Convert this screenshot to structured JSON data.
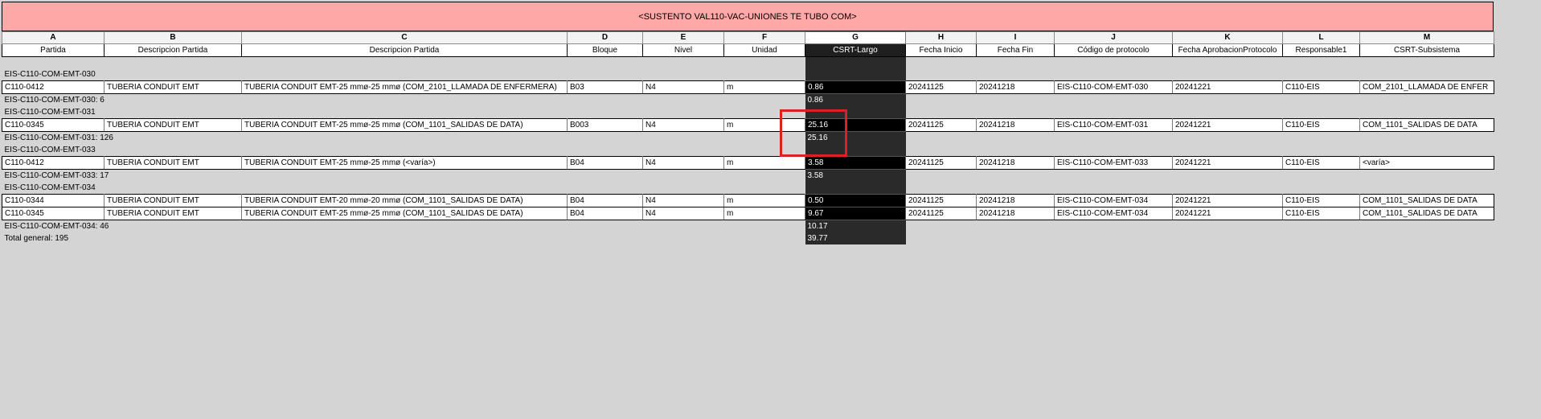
{
  "title": "<SUSTENTO VAL110-VAC-UNIONES TE TUBO COM>",
  "column_letters": [
    "A",
    "B",
    "C",
    "D",
    "E",
    "F",
    "G",
    "H",
    "I",
    "J",
    "K",
    "L",
    "M"
  ],
  "headers": [
    "Partida",
    "Descripcion Partida",
    "Descripcion Partida",
    "Bloque",
    "Nivel",
    "Unidad",
    "CSRT-Largo",
    "Fecha Inicio",
    "Fecha Fin",
    "Código de protocolo",
    "Fecha AprobacionProtocolo",
    "Responsable1",
    "CSRT-Subsistema"
  ],
  "rows": [
    {
      "type": "group",
      "label": "EIS-C110-COM-EMT-030"
    },
    {
      "type": "data",
      "cells": [
        "C110-0412",
        "TUBERIA CONDUIT EMT",
        "TUBERIA CONDUIT EMT-25 mmø-25 mmø (COM_2101_LLAMADA DE ENFERMERA)",
        "B03",
        "N4",
        "m",
        "0.86",
        "20241125",
        "20241218",
        "EIS-C110-COM-EMT-030",
        "20241221",
        "C110-EIS",
        "COM_2101_LLAMADA DE ENFER"
      ]
    },
    {
      "type": "sub",
      "label": "EIS-C110-COM-EMT-030: 6",
      "value": "0.86"
    },
    {
      "type": "group",
      "label": "EIS-C110-COM-EMT-031"
    },
    {
      "type": "data",
      "cells": [
        "C110-0345",
        "TUBERIA CONDUIT EMT",
        "TUBERIA CONDUIT EMT-25 mmø-25 mmø (COM_1101_SALIDAS DE DATA)",
        "B003",
        "N4",
        "m",
        "25.16",
        "20241125",
        "20241218",
        "EIS-C110-COM-EMT-031",
        "20241221",
        "C110-EIS",
        "COM_1101_SALIDAS DE DATA"
      ]
    },
    {
      "type": "sub",
      "label": "EIS-C110-COM-EMT-031: 126",
      "value": "25.16"
    },
    {
      "type": "group",
      "label": "EIS-C110-COM-EMT-033"
    },
    {
      "type": "data",
      "cells": [
        "C110-0412",
        "TUBERIA CONDUIT EMT",
        "TUBERIA CONDUIT EMT-25 mmø-25 mmø (<varía>)",
        "B04",
        "N4",
        "m",
        "3.58",
        "20241125",
        "20241218",
        "EIS-C110-COM-EMT-033",
        "20241221",
        "C110-EIS",
        "<varía>"
      ]
    },
    {
      "type": "sub",
      "label": "EIS-C110-COM-EMT-033: 17",
      "value": "3.58"
    },
    {
      "type": "group",
      "label": "EIS-C110-COM-EMT-034"
    },
    {
      "type": "data",
      "cells": [
        "C110-0344",
        "TUBERIA CONDUIT EMT",
        "TUBERIA CONDUIT EMT-20 mmø-20 mmø (COM_1101_SALIDAS DE DATA)",
        "B04",
        "N4",
        "m",
        "0.50",
        "20241125",
        "20241218",
        "EIS-C110-COM-EMT-034",
        "20241221",
        "C110-EIS",
        "COM_1101_SALIDAS DE DATA"
      ]
    },
    {
      "type": "data",
      "cells": [
        "C110-0345",
        "TUBERIA CONDUIT EMT",
        "TUBERIA CONDUIT EMT-25 mmø-25 mmø (COM_1101_SALIDAS DE DATA)",
        "B04",
        "N4",
        "m",
        "9.67",
        "20241125",
        "20241218",
        "EIS-C110-COM-EMT-034",
        "20241221",
        "C110-EIS",
        "COM_1101_SALIDAS DE DATA"
      ]
    },
    {
      "type": "sub",
      "label": "EIS-C110-COM-EMT-034: 46",
      "value": "10.17"
    },
    {
      "type": "total",
      "label": "Total general: 195",
      "value": "39.77"
    }
  ],
  "colors": {
    "title_bg": "#ffa8a8",
    "selected_column": "#000000",
    "highlight_box": "#e02020",
    "background": "#d4d4d4"
  }
}
